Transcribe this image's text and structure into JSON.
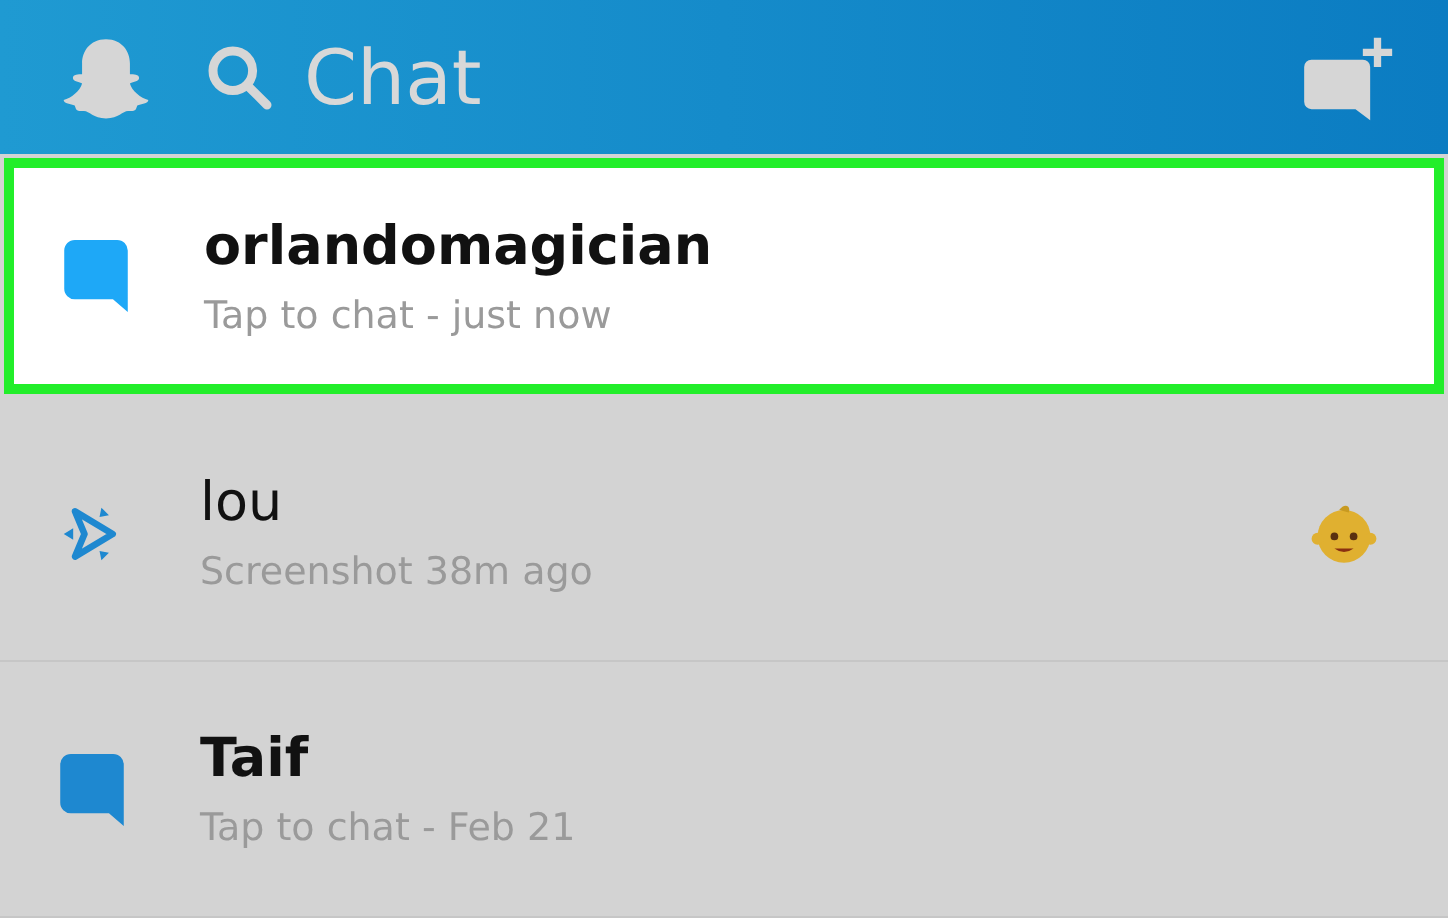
{
  "header": {
    "title": "Chat"
  },
  "chats": [
    {
      "kind": "chat",
      "name": "orlandomagician",
      "status": "Tap to chat - just now",
      "unread": true,
      "selected": true,
      "color": "#1ea8f7",
      "friend_emoji": false
    },
    {
      "kind": "screenshot",
      "name": "lou",
      "status": "Screenshot 38m ago",
      "unread": false,
      "selected": false,
      "color": "#1e88d0",
      "friend_emoji": true
    },
    {
      "kind": "chat",
      "name": "Taif",
      "status": "Tap to chat - Feb 21",
      "unread": true,
      "selected": false,
      "color": "#1e88d0",
      "friend_emoji": false
    }
  ]
}
